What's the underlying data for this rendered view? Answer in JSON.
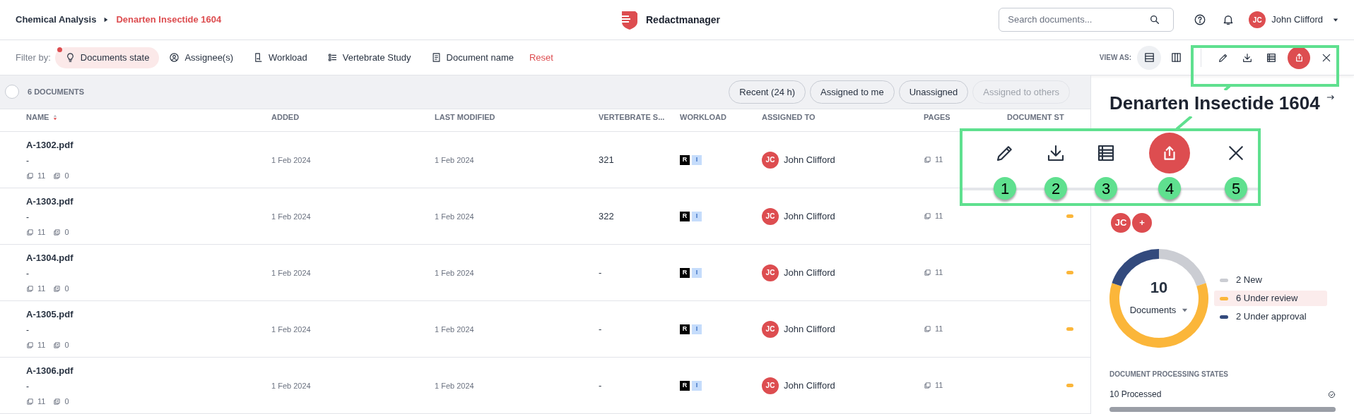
{
  "breadcrumb": [
    {
      "label": "Chemical Analysis",
      "current": false
    },
    {
      "label": "Denarten Insectide 1604",
      "current": true
    }
  ],
  "app_name": "Redactmanager",
  "search": {
    "placeholder": "Search documents..."
  },
  "user": {
    "initials": "JC",
    "name": "John Clifford"
  },
  "filter_label": "Filter by:",
  "filters": [
    {
      "label": "Documents state",
      "kind": "bulb",
      "selected": true
    },
    {
      "label": "Assignee(s)",
      "kind": "user",
      "selected": false
    },
    {
      "label": "Workload",
      "kind": "workload",
      "selected": false
    },
    {
      "label": "Vertebrate Study",
      "kind": "list",
      "selected": false
    },
    {
      "label": "Document name",
      "kind": "doc",
      "selected": false
    }
  ],
  "reset_label": "Reset",
  "view_as": {
    "label": "VIEW AS:",
    "options": [
      {
        "kind": "rows",
        "selected": true
      },
      {
        "kind": "columns",
        "selected": false
      }
    ]
  },
  "toolbar_actions": [
    {
      "kind": "edit"
    },
    {
      "kind": "download"
    },
    {
      "kind": "table"
    },
    {
      "kind": "share"
    },
    {
      "kind": "close"
    }
  ],
  "document_count": "6 DOCUMENTS",
  "quick_filters": [
    {
      "label": "Recent (24 h)",
      "disabled": false
    },
    {
      "label": "Assigned to me",
      "disabled": false
    },
    {
      "label": "Unassigned",
      "disabled": false
    },
    {
      "label": "Assigned to others",
      "disabled": true
    }
  ],
  "all_selected": false,
  "table": {
    "columns": [
      {
        "label": "NAME",
        "sort_descending": true
      },
      {
        "label": "ADDED"
      },
      {
        "label": "LAST MODIFIED"
      },
      {
        "label": "VERTEBRATE S..."
      },
      {
        "label": "WORKLOAD"
      },
      {
        "label": "ASSIGNED TO"
      },
      {
        "label": "PAGES"
      },
      {
        "label": "DOCUMENT ST"
      }
    ],
    "rows": [
      {
        "name": "A-1302.pdf",
        "note": "-",
        "pages_small": "11",
        "annotations": "0",
        "added": "1 Feb 2024",
        "modified": "1 Feb 2024",
        "vertebrate": "321",
        "workload": [
          "R",
          "I"
        ],
        "assignee_initials": "JC",
        "assignee": "John Clifford",
        "pages": "11"
      },
      {
        "name": "A-1303.pdf",
        "note": "-",
        "pages_small": "11",
        "annotations": "0",
        "added": "1 Feb 2024",
        "modified": "1 Feb 2024",
        "vertebrate": "322",
        "workload": [
          "R",
          "I"
        ],
        "assignee_initials": "JC",
        "assignee": "John Clifford",
        "pages": "11",
        "color": "#fbb63a"
      },
      {
        "name": "A-1304.pdf",
        "note": "-",
        "pages_small": "11",
        "annotations": "0",
        "added": "1 Feb 2024",
        "modified": "1 Feb 2024",
        "vertebrate": "-",
        "workload": [
          "R",
          "I"
        ],
        "assignee_initials": "JC",
        "assignee": "John Clifford",
        "pages": "11",
        "color": "#fbb63a"
      },
      {
        "name": "A-1305.pdf",
        "note": "-",
        "pages_small": "11",
        "annotations": "0",
        "added": "1 Feb 2024",
        "modified": "1 Feb 2024",
        "vertebrate": "-",
        "workload": [
          "R",
          "I"
        ],
        "assignee_initials": "JC",
        "assignee": "John Clifford",
        "pages": "11",
        "color": "#fbb63a"
      },
      {
        "name": "A-1306.pdf",
        "note": "-",
        "pages_small": "11",
        "annotations": "0",
        "added": "1 Feb 2024",
        "modified": "1 Feb 2024",
        "vertebrate": "-",
        "workload": [
          "R",
          "I"
        ],
        "assignee_initials": "JC",
        "assignee": "John Clifford",
        "pages": "11",
        "color": "#fbb63a"
      }
    ]
  },
  "panel": {
    "title": "Denarten Insectide 1604",
    "members": [
      "JC",
      "+"
    ],
    "donut": {
      "total": "10",
      "unit": "Documents",
      "legend": [
        {
          "color": "#cbcdd3",
          "selected": false
        },
        {
          "color": "#fbb63a",
          "selected": true
        },
        {
          "color": "#334a7d",
          "selected": false
        }
      ],
      "chart_data": {
        "type": "donut",
        "categories": [
          "2 New",
          "6 Under review",
          "2 Under approval"
        ],
        "values": [
          2,
          6,
          2
        ]
      }
    },
    "processing_title": "DOCUMENT PROCESSING STATES",
    "processed": {
      "label": "10 Processed",
      "level": 1
    }
  },
  "callout": {
    "items": [
      {
        "kind": "edit",
        "number": "1"
      },
      {
        "kind": "download",
        "number": "2"
      },
      {
        "kind": "table",
        "number": "3"
      },
      {
        "kind": "share",
        "number": "4"
      },
      {
        "kind": "close",
        "number": "5"
      }
    ]
  }
}
